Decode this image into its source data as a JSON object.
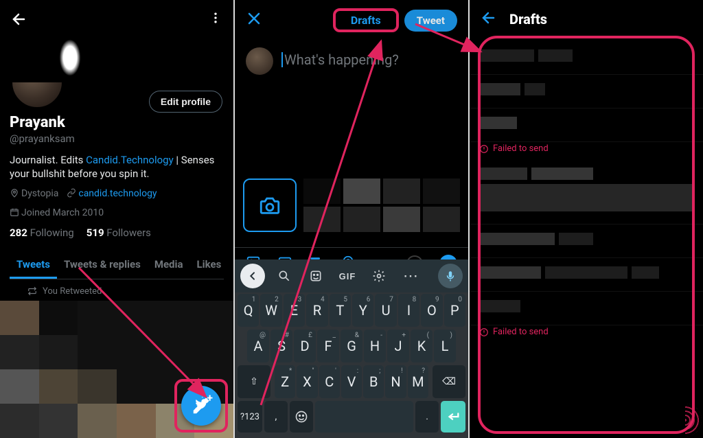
{
  "colors": {
    "accent": "#1d9bf0",
    "highlight": "#e0245e",
    "muted": "#71767b"
  },
  "panel1": {
    "edit_profile_label": "Edit profile",
    "display_name": "Prayank",
    "handle": "@prayanksam",
    "bio_prefix": "Journalist. Edits ",
    "bio_link_text": "Candid.Technology",
    "bio_suffix": " | Senses your bullshit before you spin it.",
    "location": "Dystopia",
    "url": "candid.technology",
    "joined": "Joined March 2010",
    "following_count": "282",
    "following_label": "Following",
    "followers_count": "519",
    "followers_label": "Followers",
    "tabs": {
      "tweets": "Tweets",
      "replies": "Tweets & replies",
      "media": "Media",
      "likes": "Likes"
    },
    "retweeted_label": "You Retweeted"
  },
  "panel2": {
    "drafts_label": "Drafts",
    "tweet_button_label": "Tweet",
    "placeholder": "What's happening?",
    "keyboard": {
      "row1": [
        [
          "Q",
          "1"
        ],
        [
          "W",
          "2"
        ],
        [
          "E",
          "3"
        ],
        [
          "R",
          "4"
        ],
        [
          "T",
          "5"
        ],
        [
          "Y",
          "6"
        ],
        [
          "U",
          "7"
        ],
        [
          "I",
          "8"
        ],
        [
          "O",
          "9"
        ],
        [
          "P",
          "0"
        ]
      ],
      "row2": [
        [
          "A",
          "@"
        ],
        [
          "S",
          "#"
        ],
        [
          "D",
          "£"
        ],
        [
          "F",
          "_"
        ],
        [
          "G",
          "&"
        ],
        [
          "H",
          "-"
        ],
        [
          "J",
          "+"
        ],
        [
          "K",
          "("
        ],
        [
          "L",
          ")"
        ]
      ],
      "row3": [
        [
          "Z",
          "*"
        ],
        [
          "X",
          "\""
        ],
        [
          "C",
          "'"
        ],
        [
          "V",
          ":"
        ],
        [
          "B",
          ";"
        ],
        [
          "N",
          "!"
        ],
        [
          "M",
          "?"
        ]
      ],
      "shift_icon": "⇧",
      "backspace_icon": "⌫",
      "numeric_label": "?123",
      "comma": ",",
      "period": ".",
      "gif_label": "GIF"
    }
  },
  "panel3": {
    "title": "Drafts",
    "failed_label": "Failed to send"
  }
}
